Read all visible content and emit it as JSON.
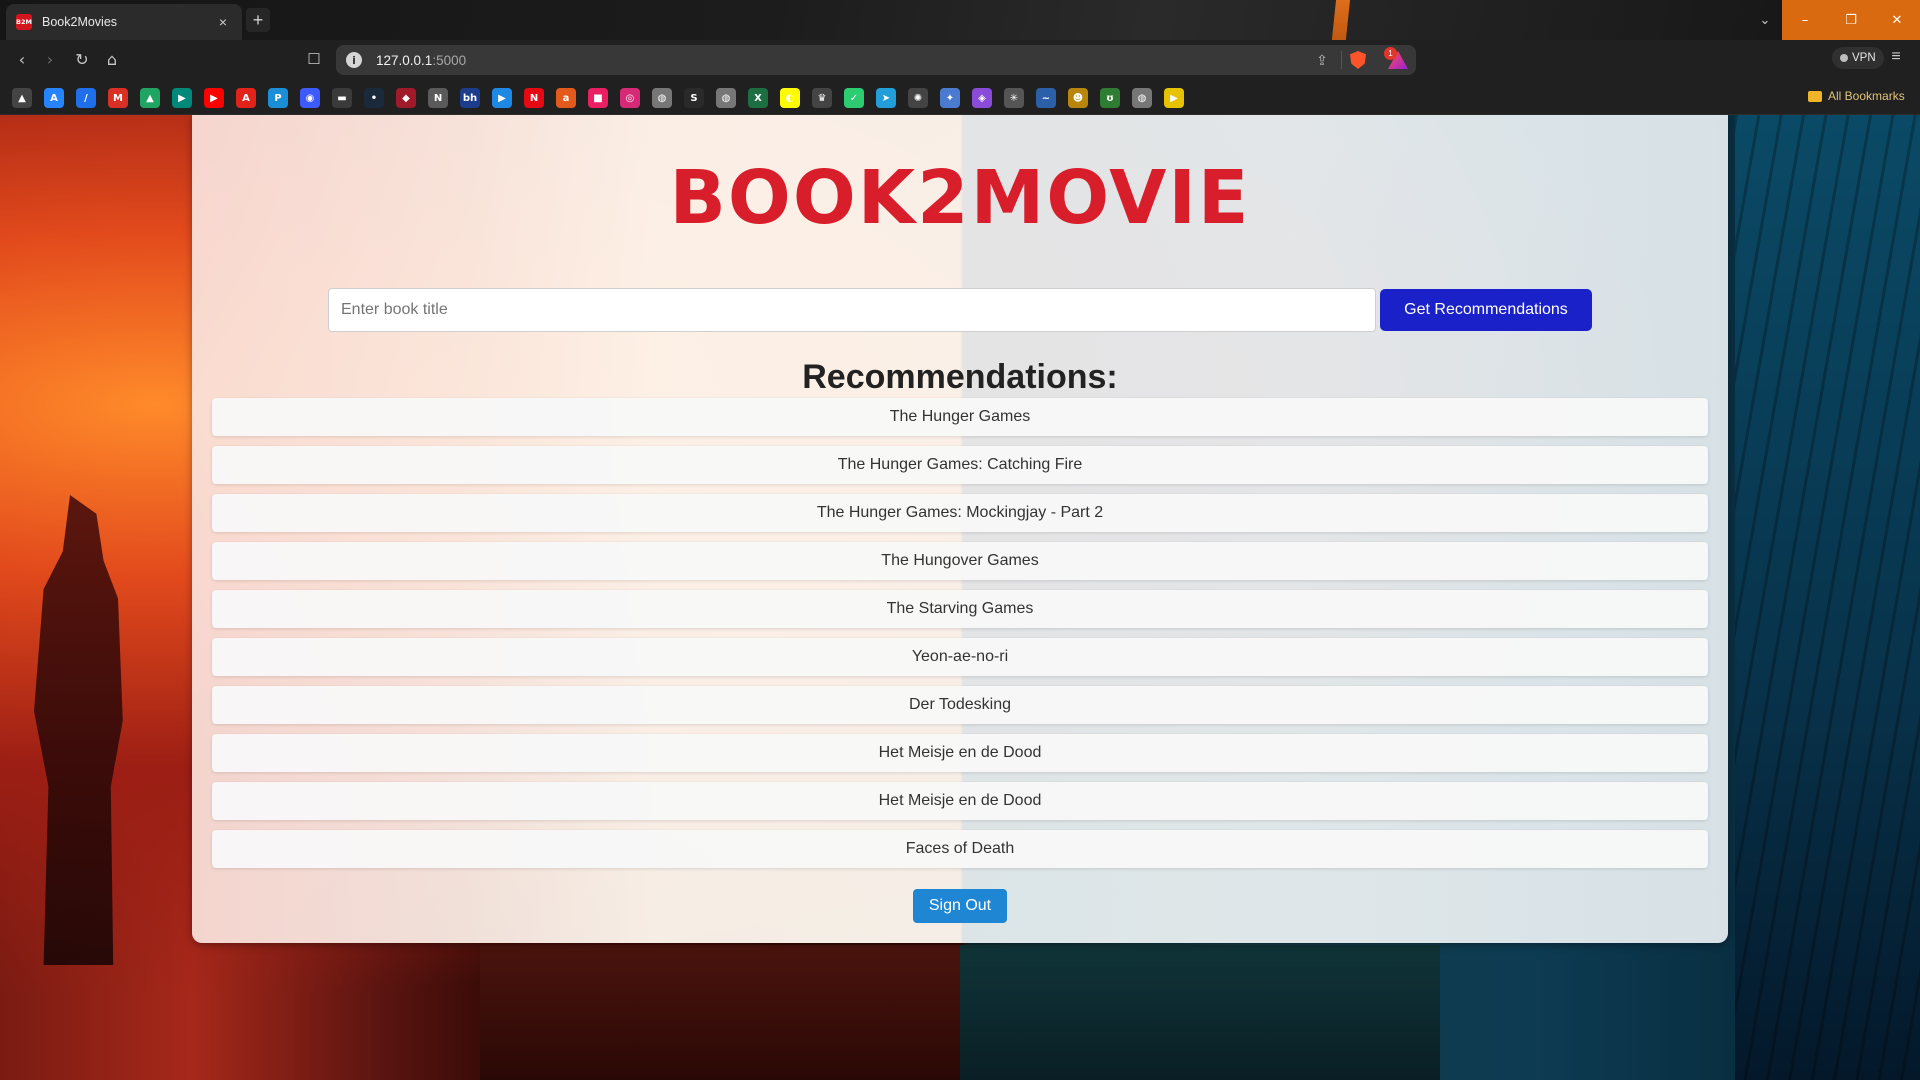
{
  "browser": {
    "tab": {
      "favicon_text": "B2M",
      "title": "Book2Movies",
      "close": "×"
    },
    "new_tab": "+",
    "tabs_dropdown": "⌄",
    "window_controls": {
      "minimize": "–",
      "restore": "❐",
      "close": "✕"
    },
    "nav": {
      "back": "‹",
      "forward": "›",
      "reload": "↻",
      "home": "⌂",
      "bookmark": "🔖"
    },
    "address": {
      "host": "127.0.0.1",
      "port": ":5000",
      "info": "i",
      "share": "⇪"
    },
    "rewards_badge": "1",
    "vpn_label": "VPN",
    "menu": "≡",
    "all_bookmarks": "All Bookmarks",
    "extensions": [
      {
        "icon": "ext-green-icon",
        "color": "#2f9e44"
      },
      {
        "icon": "ext-red-icon",
        "color": "#d63a3a"
      },
      {
        "icon": "ext-flag-icon",
        "color": "#555555"
      },
      {
        "icon": "ext-mask-icon",
        "color": "#777777"
      },
      {
        "icon": "ext-card-icon",
        "color": "#666666"
      },
      {
        "icon": "ext-clock-icon",
        "color": "#888888"
      },
      {
        "icon": "ext-puzzle-icon",
        "color": "#555555"
      },
      {
        "icon": "ext-music-icon",
        "color": "#555555"
      },
      {
        "icon": "ext-sidebar-icon",
        "color": "#555555"
      },
      {
        "icon": "ext-wallet-icon",
        "color": "#555555"
      }
    ],
    "bookmarks": [
      {
        "icon": "flask-icon",
        "glyph": "▲",
        "color": "#444444"
      },
      {
        "icon": "atlassian-icon",
        "glyph": "A",
        "color": "#2684ff"
      },
      {
        "icon": "slash-icon",
        "glyph": "/",
        "color": "#1f6feb"
      },
      {
        "icon": "gmail-icon",
        "glyph": "M",
        "color": "#d93025"
      },
      {
        "icon": "drive-icon",
        "glyph": "▲",
        "color": "#1fa463"
      },
      {
        "icon": "meet-icon",
        "glyph": "▶",
        "color": "#00897b"
      },
      {
        "icon": "youtube-icon",
        "glyph": "▶",
        "color": "#ff0000"
      },
      {
        "icon": "acrobat-icon",
        "glyph": "A",
        "color": "#e2231a"
      },
      {
        "icon": "p-icon",
        "glyph": "P",
        "color": "#1a8ed6"
      },
      {
        "icon": "chat-icon",
        "glyph": "◉",
        "color": "#3d5afe"
      },
      {
        "icon": "cloud-icon",
        "glyph": "▬",
        "color": "#3a3a3a"
      },
      {
        "icon": "dot-icon",
        "glyph": "•",
        "color": "#1b2a3a"
      },
      {
        "icon": "dice-icon",
        "glyph": "◆",
        "color": "#a11a2a"
      },
      {
        "icon": "news-icon",
        "glyph": "N",
        "color": "#5a5a5a"
      },
      {
        "icon": "bh-icon",
        "glyph": "bh",
        "color": "#1c3c8c"
      },
      {
        "icon": "play-icon",
        "glyph": "▶",
        "color": "#1e88e5"
      },
      {
        "icon": "netflix-icon",
        "glyph": "N",
        "color": "#e50914"
      },
      {
        "icon": "aisa-icon",
        "glyph": "a",
        "color": "#e25a1c"
      },
      {
        "icon": "bag-icon",
        "glyph": "■",
        "color": "#e91e63"
      },
      {
        "icon": "instagram-icon",
        "glyph": "◎",
        "color": "#d62976"
      },
      {
        "icon": "globe-icon",
        "glyph": "◍",
        "color": "#777777"
      },
      {
        "icon": "s-icon",
        "glyph": "S",
        "color": "#2a2a2a"
      },
      {
        "icon": "globe2-icon",
        "glyph": "◍",
        "color": "#777777"
      },
      {
        "icon": "excel-icon",
        "glyph": "X",
        "color": "#1d6f42"
      },
      {
        "icon": "snapchat-icon",
        "glyph": "◐",
        "color": "#fffc00"
      },
      {
        "icon": "crown-icon",
        "glyph": "♛",
        "color": "#444444"
      },
      {
        "icon": "check-icon",
        "glyph": "✓",
        "color": "#2ecc71"
      },
      {
        "icon": "telegram-icon",
        "glyph": "➤",
        "color": "#229ed9"
      },
      {
        "icon": "openai-icon",
        "glyph": "✺",
        "color": "#444444"
      },
      {
        "icon": "gemini-icon",
        "glyph": "✦",
        "color": "#4a7bd0"
      },
      {
        "icon": "copilot-icon",
        "glyph": "◈",
        "color": "#8a4bd8"
      },
      {
        "icon": "spark-icon",
        "glyph": "✳",
        "color": "#555555"
      },
      {
        "icon": "wave-icon",
        "glyph": "~",
        "color": "#2b5fa8"
      },
      {
        "icon": "bot-icon",
        "glyph": "☻",
        "color": "#b8860b"
      },
      {
        "icon": "leaf-icon",
        "glyph": "ʊ",
        "color": "#2e7d32"
      },
      {
        "icon": "globe3-icon",
        "glyph": "◍",
        "color": "#777777"
      },
      {
        "icon": "yt-music-icon",
        "glyph": "▶",
        "color": "#e6c200"
      }
    ]
  },
  "page": {
    "logo": "BOOK2MOVIE",
    "search": {
      "placeholder": "Enter book title",
      "value": ""
    },
    "button_label": "Get Recommendations",
    "heading": "Recommendations:",
    "recommendations": [
      "The Hunger Games",
      "The Hunger Games: Catching Fire",
      "The Hunger Games: Mockingjay - Part 2",
      "The Hungover Games",
      "The Starving Games",
      "Yeon-ae-no-ri",
      "Der Todesking",
      "Het Meisje en de Dood",
      "Het Meisje en de Dood",
      "Faces of Death"
    ],
    "signout_label": "Sign Out"
  },
  "colors": {
    "logo": "#d81e2b",
    "primary_button": "#1a21c9",
    "signout_button": "#1f86d4",
    "window_controls": "#d96a10"
  }
}
